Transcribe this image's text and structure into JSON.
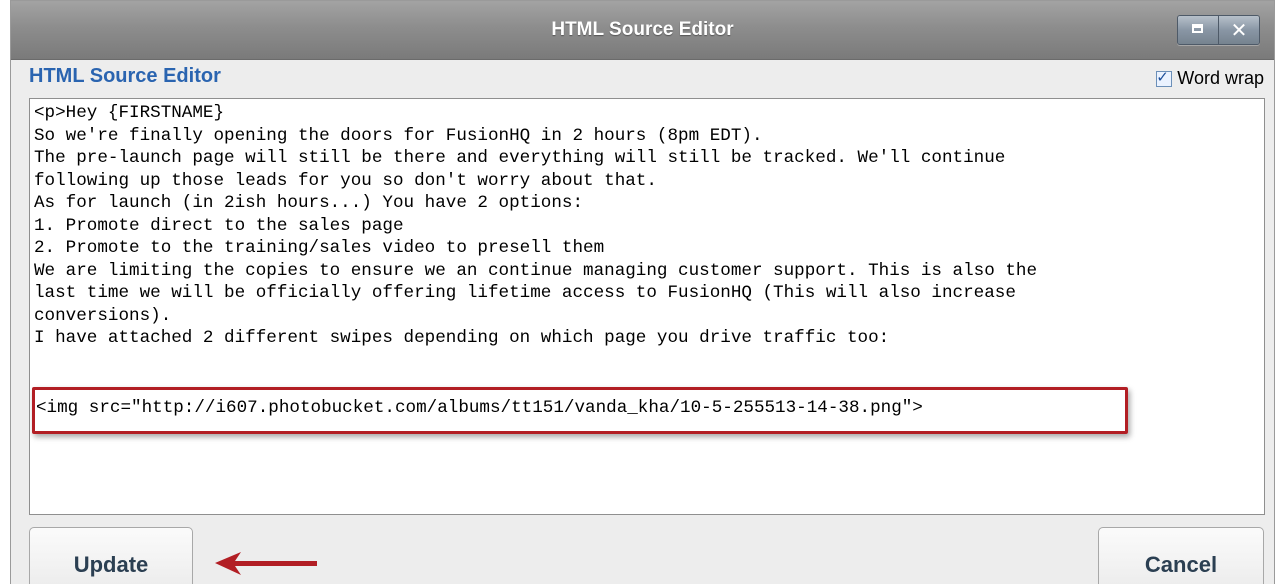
{
  "window": {
    "title": "HTML Source Editor"
  },
  "header": {
    "heading": "HTML Source Editor",
    "wordwrap_label": "Word wrap",
    "wordwrap_checked": true
  },
  "editor": {
    "lines": [
      "<p>Hey {FIRSTNAME}",
      "So we're finally opening the doors for FusionHQ in 2 hours (8pm EDT).",
      "The pre-launch page will still be there and everything will still be tracked. We'll continue",
      "following up those leads for you so don't worry about that.",
      "As for launch (in 2ish hours...) You have 2 options:",
      "1. Promote direct to the sales page",
      "2. Promote to the training/sales video to presell them",
      "We are limiting the copies to ensure we an continue managing customer support. This is also the",
      "last time we will be officially offering lifetime access to FusionHQ (This will also increase",
      "conversions).",
      "I have attached 2 different swipes depending on which page you drive traffic too:"
    ],
    "highlighted_line": "<img src=\"http://i607.photobucket.com/albums/tt151/vanda_kha/10-5-255513-14-38.png\">"
  },
  "buttons": {
    "update": "Update",
    "cancel": "Cancel"
  },
  "colors": {
    "heading": "#2a64b0",
    "highlight": "#b21e24",
    "arrow": "#b21e24"
  },
  "icons": {
    "maximize": "maximize-icon",
    "close": "close-icon",
    "checkbox": "checkmark-icon",
    "annotation_arrow": "arrow-left-icon"
  }
}
